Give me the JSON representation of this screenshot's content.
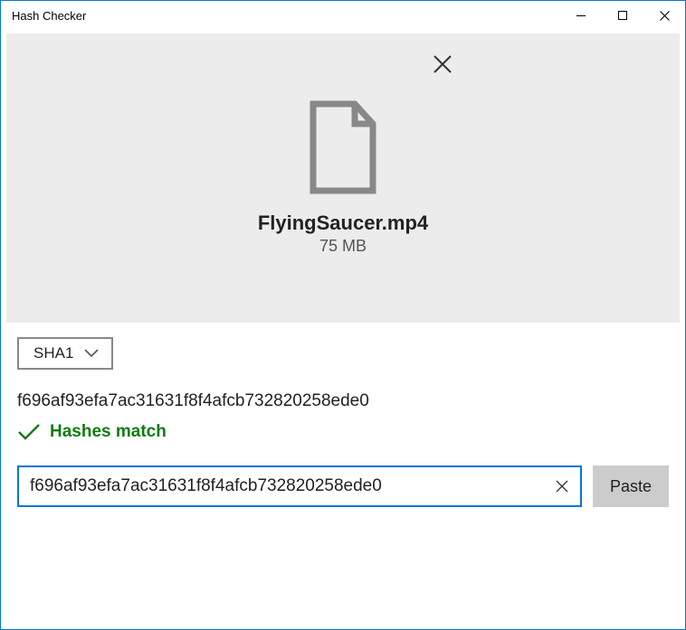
{
  "window": {
    "title": "Hash Checker"
  },
  "file": {
    "name": "FlyingSaucer.mp4",
    "size": "75 MB"
  },
  "algorithm": {
    "selected": "SHA1"
  },
  "computed_hash": "f696af93efa7ac31631f8f4afcb732820258ede0",
  "status": {
    "text": "Hashes match",
    "color": "#107c10"
  },
  "compare": {
    "value": "f696af93efa7ac31631f8f4afcb732820258ede0",
    "paste_label": "Paste"
  }
}
